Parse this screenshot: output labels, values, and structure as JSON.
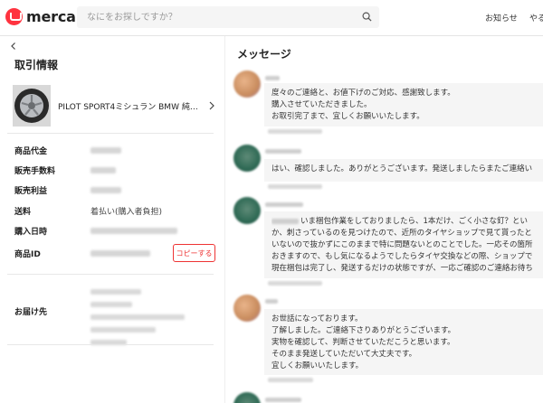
{
  "header": {
    "logo_text": "mercari",
    "search_placeholder": "なにをお探しですか？",
    "nav_notifications": "お知らせ",
    "nav_todo": "やる"
  },
  "left": {
    "title": "取引情報",
    "product_name": "PILOT SPORT4ミシュラン BMW 純…",
    "rows": [
      {
        "label": "商品代金"
      },
      {
        "label": "販売手数料"
      },
      {
        "label": "販売利益"
      },
      {
        "label": "送料",
        "value": "着払い(購入者負担)"
      },
      {
        "label": "購入日時"
      },
      {
        "label": "商品ID"
      }
    ],
    "copy_label": "コピーする",
    "address_label": "お届け先"
  },
  "messages": {
    "title": "メッセージ",
    "items": [
      {
        "lines": [
          "度々のご連絡と、お値下げのご対応、感謝致します。",
          "購入させていただきました。",
          "お取引完了まで、宜しくお願いいたします。"
        ]
      },
      {
        "lines": [
          "はい、確認しました。ありがとうございます。発送しましたらまたご連絡い"
        ]
      },
      {
        "lines": [
          "いま梱包作業をしておりましたら、1本だけ、ごく小さな釘？とい",
          "か、刺さっているのを見つけたので、近所のタイヤショップで見て貰ったと",
          "いないので抜かずにこのままで特に問題ないとのことでした。一応その箇所",
          "おきますので、もし気になるようでしたらタイヤ交換などの際、ショップで",
          "現在梱包は完了し、発送するだけの状態ですが、一応ご確認のご連絡お待ち"
        ]
      },
      {
        "lines": [
          "お世話になっております。",
          "了解しました。ご連絡下さりありがとうございます。",
          "実物を確認して、判断させていただこうと思います。",
          "そのまま発送していただいて大丈夫です。",
          "宜しくお願いいたします。"
        ]
      }
    ]
  }
}
